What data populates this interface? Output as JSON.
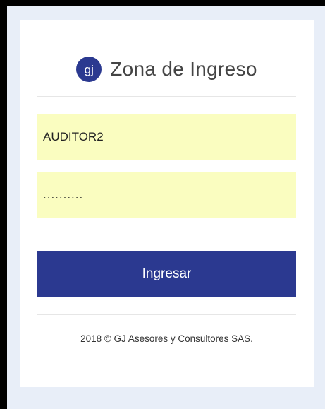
{
  "login": {
    "logo_text": "gj",
    "title": "Zona de Ingreso",
    "username_value": "AUDITOR2",
    "password_value": "..........",
    "submit_label": "Ingresar",
    "footer": "2018 © GJ Asesores y Consultores SAS."
  },
  "colors": {
    "brand": "#2b3990",
    "field_bg": "#fafdc0",
    "page_bg": "#e8eef8"
  }
}
